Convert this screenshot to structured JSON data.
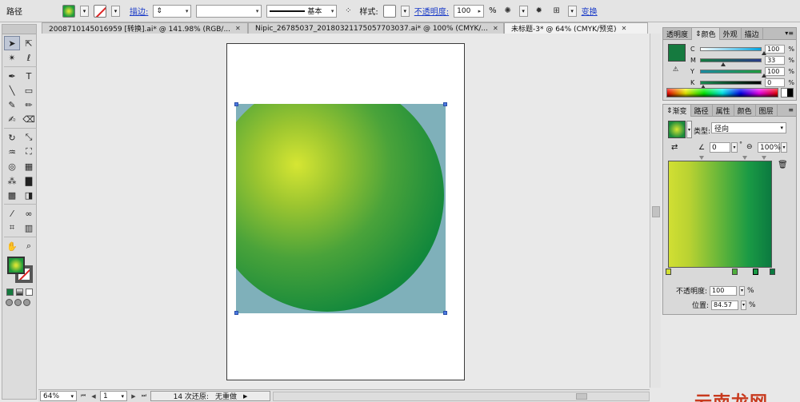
{
  "control_bar": {
    "object_type": "路径",
    "stroke_label": "描边:",
    "stroke_profile": "基本",
    "style_label": "样式:",
    "opacity_label": "不透明度:",
    "opacity_value": "100",
    "opacity_unit": "%",
    "transform_label": "变换"
  },
  "tabs": [
    {
      "label": "2008710145016959 [转换].ai* @ 141.98% (RGB/..."
    },
    {
      "label": "Nipic_26785037_20180321175057703037.ai* @ 100% (CMYK/..."
    },
    {
      "label": "未标题-3* @ 64% (CMYK/预览)"
    }
  ],
  "toolbox": {
    "tools": [
      {
        "name": "selection-tool",
        "glyph": "➤"
      },
      {
        "name": "direct-selection-tool",
        "glyph": "⇱"
      },
      {
        "name": "magic-wand-tool",
        "glyph": "✴"
      },
      {
        "name": "lasso-tool",
        "glyph": "ℓ"
      },
      {
        "name": "pen-tool",
        "glyph": "✒"
      },
      {
        "name": "type-tool",
        "glyph": "T"
      },
      {
        "name": "line-tool",
        "glyph": "╲"
      },
      {
        "name": "rectangle-tool",
        "glyph": "▭"
      },
      {
        "name": "paintbrush-tool",
        "glyph": "✎"
      },
      {
        "name": "pencil-tool",
        "glyph": "✏"
      },
      {
        "name": "blob-brush-tool",
        "glyph": "✍"
      },
      {
        "name": "eraser-tool",
        "glyph": "⌫"
      },
      {
        "name": "rotate-tool",
        "glyph": "↻"
      },
      {
        "name": "scale-tool",
        "glyph": "⤡"
      },
      {
        "name": "warp-tool",
        "glyph": "♒"
      },
      {
        "name": "free-transform-tool",
        "glyph": "⛶"
      },
      {
        "name": "shape-builder-tool",
        "glyph": "◎"
      },
      {
        "name": "perspective-grid-tool",
        "glyph": "▦"
      },
      {
        "name": "symbol-sprayer-tool",
        "glyph": "⁂"
      },
      {
        "name": "column-graph-tool",
        "glyph": "▇"
      },
      {
        "name": "mesh-tool",
        "glyph": "▩"
      },
      {
        "name": "gradient-tool",
        "glyph": "◨"
      },
      {
        "name": "eyedropper-tool",
        "glyph": "⁄"
      },
      {
        "name": "blend-tool",
        "glyph": "∞"
      },
      {
        "name": "slice-tool",
        "glyph": "⌗"
      },
      {
        "name": "chart-tool",
        "glyph": "▥"
      },
      {
        "name": "hand-tool",
        "glyph": "✋"
      },
      {
        "name": "zoom-tool",
        "glyph": "⌕"
      }
    ]
  },
  "colors": {
    "fill_green": "#157a3f",
    "sphere_center": "#d6e633",
    "sphere_edge": "#0f7b3a",
    "background_teal": "#7fb0ba"
  },
  "color_panel": {
    "tabs": [
      "透明度",
      "颜色",
      "外观",
      "描边"
    ],
    "active_tab": "颜色",
    "channels": [
      {
        "name": "C",
        "value": "100",
        "pos": 1.0
      },
      {
        "name": "M",
        "value": "33",
        "pos": 0.33
      },
      {
        "name": "Y",
        "value": "100",
        "pos": 1.0
      },
      {
        "name": "K",
        "value": "0",
        "pos": 0.0
      }
    ],
    "percent": "%"
  },
  "gradient_panel": {
    "tabs": [
      "渐变",
      "路径",
      "属性",
      "颜色",
      "图层"
    ],
    "active_tab": "渐变",
    "type_label": "类型:",
    "type_value": "径向",
    "angle_value": "0",
    "aspect_value": "100",
    "percent": "%",
    "degree": "°",
    "stops": [
      {
        "pos": 0.0,
        "color": "#d1df33"
      },
      {
        "pos": 0.64,
        "color": "#4fae3c"
      },
      {
        "pos": 0.84,
        "color": "#1a9a45"
      },
      {
        "pos": 1.0,
        "color": "#0b7a40"
      }
    ],
    "midpoints": [
      0.32,
      0.74,
      0.92
    ],
    "opacity_label": "不透明度:",
    "opacity_value": "100",
    "location_label": "位置:",
    "location_value": "84.57"
  },
  "status_bar": {
    "zoom": "64%",
    "page": "1",
    "undo_status": "14 次还原:",
    "redo_status": "无重做"
  },
  "watermark": "云南龙网"
}
